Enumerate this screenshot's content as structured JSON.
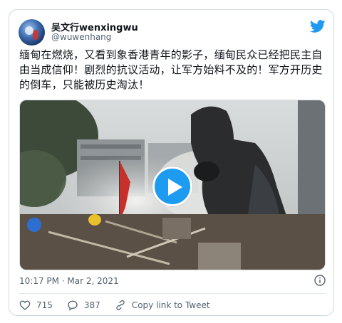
{
  "tweet": {
    "author_name": "吴文行wenxingwu",
    "author_handle": "@wuwenhang",
    "text": "缅甸在燃烧，又看到象香港青年的影子，缅甸民众已经把民主自由当成信仰！剧烈的抗议活动，让军方始料不及的！军方开历史的倒车，只能被历史淘汰！",
    "timestamp": "10:17 PM · Mar 2, 2021",
    "likes": "715",
    "replies": "387",
    "copy_link_label": "Copy link to Tweet"
  },
  "icons": {
    "brand": "twitter-bird-icon",
    "play": "play-icon",
    "info": "info-icon",
    "like": "heart-icon",
    "reply": "reply-bubble-icon",
    "link": "link-icon"
  },
  "colors": {
    "accent": "#1d9bf0",
    "text": "#0f1419",
    "secondary": "#536471",
    "border": "#cfd9de"
  }
}
